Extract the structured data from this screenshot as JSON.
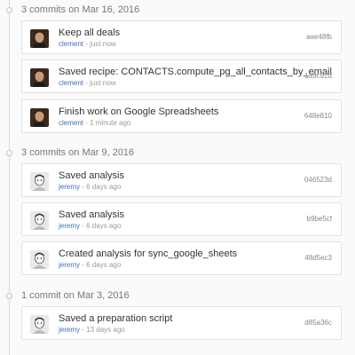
{
  "groups": [
    {
      "title": "3 commits on Mar 16, 2016",
      "commits": [
        {
          "message": "Keep all deals",
          "author": "clement",
          "separator": " - ",
          "time": "just now",
          "sha": "aae48fb"
        },
        {
          "message": "Saved recipe: CONTACTS.compute_pg_all_contacts_by_email",
          "author": "clement",
          "separator": " - ",
          "time": "just now",
          "sha": "1a9c92d"
        },
        {
          "message": "Finish work on Google Spreadsheets",
          "author": "clement",
          "separator": " - ",
          "time": "1 minute ago",
          "sha": "648e810"
        }
      ]
    },
    {
      "title": "3 commits on Mar 9, 2016",
      "commits": [
        {
          "message": "Saved analysis",
          "author": "jeremy",
          "separator": " - ",
          "time": "6 days ago",
          "sha": "046523d"
        },
        {
          "message": "Saved analysis",
          "author": "jeremy",
          "separator": " - ",
          "time": "6 days ago",
          "sha": "b9be5cf"
        },
        {
          "message": "Created analysis for sync_google_sheets",
          "author": "jeremy",
          "separator": " - ",
          "time": "6 days ago",
          "sha": "48d5ec3"
        }
      ]
    },
    {
      "title": "1 commit on Mar 3, 2016",
      "commits": [
        {
          "message": "Saved a preparation script",
          "author": "jeremy",
          "separator": " - ",
          "time": "13 days ago",
          "sha": "d85a36c"
        }
      ]
    }
  ],
  "colors": {
    "author_link": "#3b73b9",
    "clement_avatar_bg": "#3a2a1e",
    "jeremy_avatar_bg": "#e9e9e9"
  },
  "icons": {
    "clement_avatar": "user-photo-avatar",
    "jeremy_avatar": "user-sketch-avatar"
  }
}
